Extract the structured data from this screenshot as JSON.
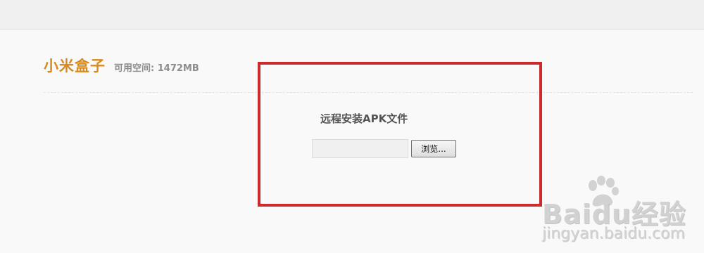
{
  "header": {
    "device_name": "小米盒子",
    "storage_text": "可用空间: 1472MB"
  },
  "upload": {
    "title": "远程安装APK文件",
    "file_input_value": "",
    "browse_label": "浏览..."
  },
  "annotation": {
    "highlight_color": "#cc2b2b"
  },
  "watermark": {
    "brand": "Baidu经验",
    "url": "jingyan.baidu.com",
    "icon": "paw-icon"
  }
}
